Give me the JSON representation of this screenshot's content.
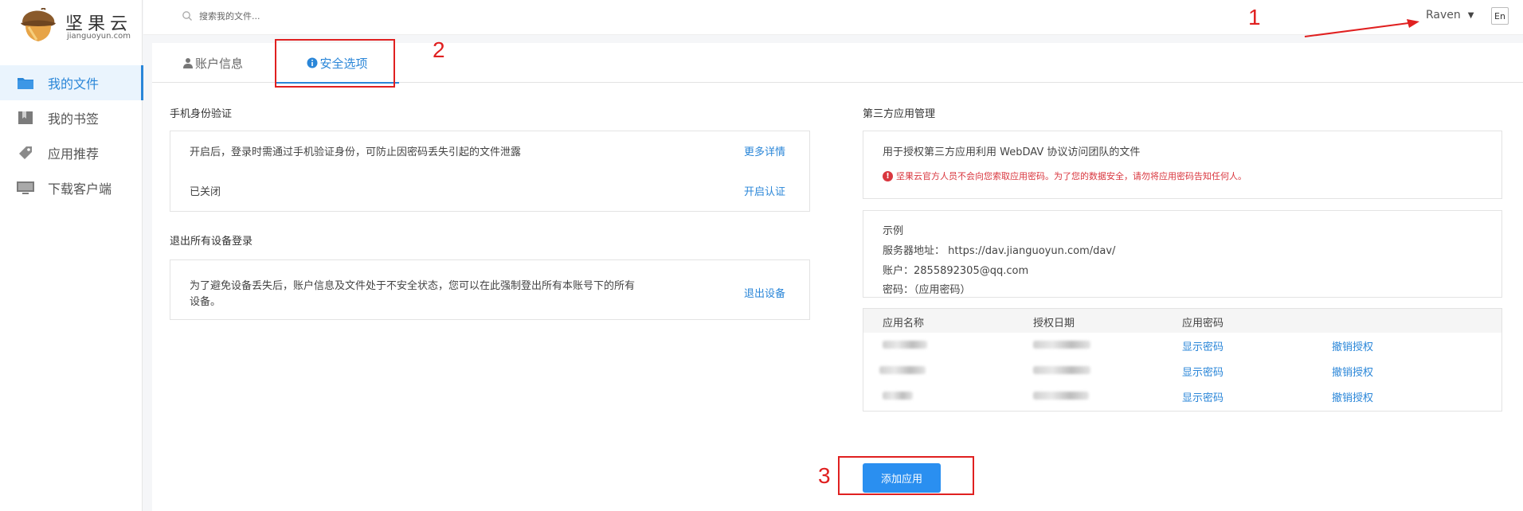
{
  "brand": {
    "name": "坚果云",
    "domain": "jianguoyun.com"
  },
  "sidebar": {
    "items": [
      {
        "label": "我的文件",
        "icon": "folder-icon",
        "active": true
      },
      {
        "label": "我的书签",
        "icon": "bookmark-icon",
        "active": false
      },
      {
        "label": "应用推荐",
        "icon": "tag-icon",
        "active": false
      },
      {
        "label": "下载客户端",
        "icon": "monitor-icon",
        "active": false
      }
    ]
  },
  "header": {
    "search_placeholder": "搜索我的文件...",
    "user_name": "Raven",
    "lang_button": "En"
  },
  "annotations": {
    "n1": "1",
    "n2": "2",
    "n3": "3"
  },
  "tabs": [
    {
      "label": "账户信息",
      "icon": "user-icon",
      "active": false
    },
    {
      "label": "安全选项",
      "icon": "info-icon",
      "active": true
    }
  ],
  "phone_auth": {
    "title": "手机身份验证",
    "description": "开启后，登录时需通过手机验证身份，可防止因密码丢失引起的文件泄露",
    "more_link": "更多详情",
    "status": "已关闭",
    "enable_link": "开启认证"
  },
  "logout_all": {
    "title": "退出所有设备登录",
    "description_line1": "为了避免设备丢失后，账户信息及文件处于不安全状态，您可以在此强制登出所有本账号下的所有",
    "description_line2": "设备。",
    "action_link": "退出设备"
  },
  "third_party": {
    "title": "第三方应用管理",
    "intro": "用于授权第三方应用利用 WebDAV 协议访问团队的文件",
    "warning": "坚果云官方人员不会向您索取应用密码。为了您的数据安全，请勿将应用密码告知任何人。",
    "example": {
      "heading": "示例",
      "server_label": "服务器地址：",
      "server_value": "https://dav.jianguoyun.com/dav/",
      "account_label": "账户：",
      "account_value": "2855892305@qq.com",
      "password_label": "密码：",
      "password_value": "（应用密码）"
    },
    "table": {
      "headers": [
        "应用名称",
        "授权日期",
        "应用密码"
      ],
      "rows": [
        {
          "show_password": "显示密码",
          "revoke": "撤销授权"
        },
        {
          "show_password": "显示密码",
          "revoke": "撤销授权"
        },
        {
          "show_password": "显示密码",
          "revoke": "撤销授权"
        }
      ]
    },
    "add_button": "添加应用"
  },
  "colors": {
    "accent": "#2a86d8",
    "button": "#2a8ff0",
    "annotation": "#e02020",
    "warning": "#d9363e"
  }
}
